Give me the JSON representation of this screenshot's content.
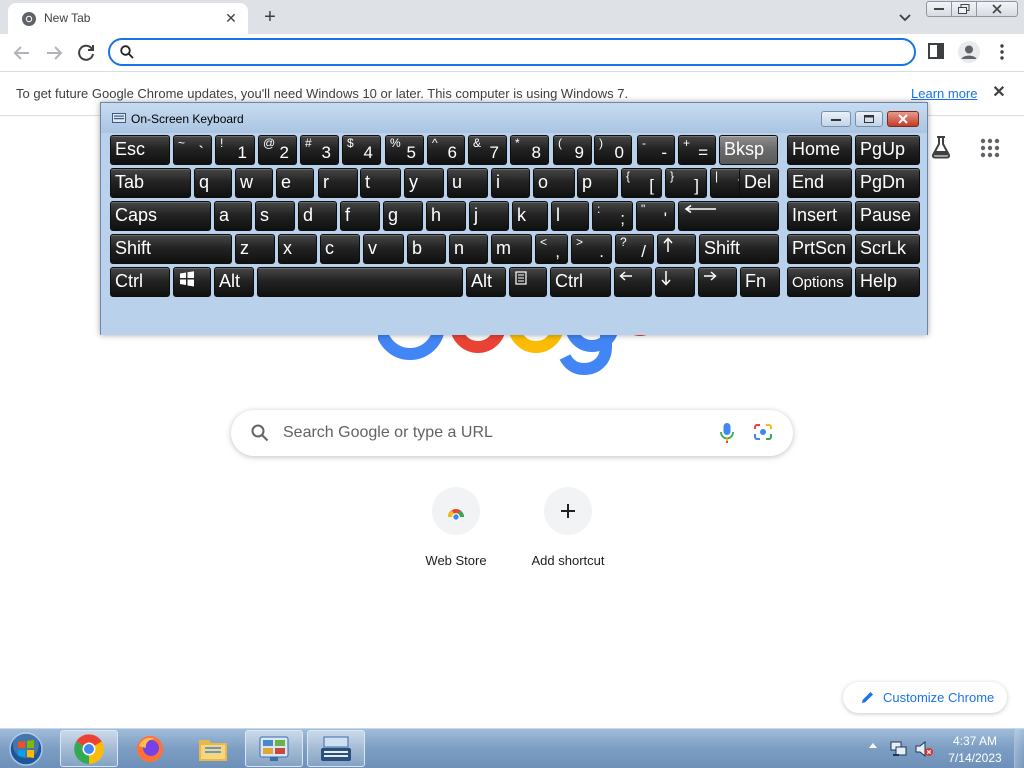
{
  "browser": {
    "tab": {
      "title": "New Tab"
    },
    "omnibox": {
      "value": "",
      "placeholder": ""
    },
    "infobar": {
      "message": "To get future Google Chrome updates, you'll need Windows 10 or later. This computer is using Windows 7.",
      "link": "Learn more"
    }
  },
  "ntp": {
    "search": {
      "placeholder": "Search Google or type a URL"
    },
    "shortcuts": [
      {
        "label": "Web Store",
        "icon": "chrome-web-store-icon"
      },
      {
        "label": "Add shortcut",
        "icon": "plus-icon"
      }
    ],
    "customize_label": "Customize Chrome"
  },
  "osk": {
    "title": "On-Screen Keyboard",
    "highlighted_key": "Bksp",
    "rows": [
      [
        {
          "main": "Esc"
        },
        {
          "shift": "~",
          "base": "`"
        },
        {
          "shift": "!",
          "base": "1"
        },
        {
          "shift": "@",
          "base": "2"
        },
        {
          "shift": "#",
          "base": "3"
        },
        {
          "shift": "$",
          "base": "4"
        },
        {
          "shift": "%",
          "base": "5"
        },
        {
          "shift": "^",
          "base": "6"
        },
        {
          "shift": "&",
          "base": "7"
        },
        {
          "shift": "*",
          "base": "8"
        },
        {
          "shift": "(",
          "base": "9"
        },
        {
          "shift": ")",
          "base": "0"
        },
        {
          "shift": "-",
          "base": "-"
        },
        {
          "shift": "+",
          "base": "="
        },
        {
          "main": "Bksp"
        },
        {
          "main": "Home"
        },
        {
          "main": "PgUp"
        }
      ],
      [
        {
          "main": "Tab"
        },
        {
          "main": "q"
        },
        {
          "main": "w"
        },
        {
          "main": "e"
        },
        {
          "main": "r"
        },
        {
          "main": "t"
        },
        {
          "main": "y"
        },
        {
          "main": "u"
        },
        {
          "main": "i"
        },
        {
          "main": "o"
        },
        {
          "main": "p"
        },
        {
          "shift": "{",
          "base": "["
        },
        {
          "shift": "}",
          "base": "]"
        },
        {
          "shift": "|",
          "base": "\\"
        },
        {
          "main": "Del"
        },
        {
          "main": "End"
        },
        {
          "main": "PgDn"
        }
      ],
      [
        {
          "main": "Caps"
        },
        {
          "main": "a"
        },
        {
          "main": "s"
        },
        {
          "main": "d"
        },
        {
          "main": "f"
        },
        {
          "main": "g"
        },
        {
          "main": "h"
        },
        {
          "main": "j"
        },
        {
          "main": "k"
        },
        {
          "main": "l"
        },
        {
          "shift": ":",
          "base": ";"
        },
        {
          "shift": "\"",
          "base": "'"
        },
        {
          "main": "",
          "icon": "enter-arrow-icon"
        },
        {
          "main": "Insert"
        },
        {
          "main": "Pause"
        }
      ],
      [
        {
          "main": "Shift"
        },
        {
          "main": "z"
        },
        {
          "main": "x"
        },
        {
          "main": "c"
        },
        {
          "main": "v"
        },
        {
          "main": "b"
        },
        {
          "main": "n"
        },
        {
          "main": "m"
        },
        {
          "shift": "<",
          "base": ","
        },
        {
          "shift": ">",
          "base": "."
        },
        {
          "shift": "?",
          "base": "/"
        },
        {
          "main": "",
          "icon": "up-arrow-icon"
        },
        {
          "main": "Shift"
        },
        {
          "main": "PrtScn"
        },
        {
          "main": "ScrLk"
        }
      ],
      [
        {
          "main": "Ctrl"
        },
        {
          "main": "",
          "icon": "windows-logo-icon"
        },
        {
          "main": "Alt"
        },
        {
          "main": "",
          "icon": "spacebar"
        },
        {
          "main": "Alt"
        },
        {
          "main": "",
          "icon": "context-menu-icon"
        },
        {
          "main": "Ctrl"
        },
        {
          "main": "",
          "icon": "left-arrow-icon"
        },
        {
          "main": "",
          "icon": "down-arrow-icon"
        },
        {
          "main": "",
          "icon": "right-arrow-icon"
        },
        {
          "main": "Fn"
        },
        {
          "main": "Options"
        },
        {
          "main": "Help"
        }
      ]
    ]
  },
  "taskbar": {
    "apps": [
      "chrome-icon",
      "firefox-icon",
      "file-explorer-icon",
      "control-panel-icon",
      "on-screen-keyboard-icon"
    ],
    "clock": {
      "time": "4:37 AM",
      "date": "7/14/2023"
    }
  }
}
